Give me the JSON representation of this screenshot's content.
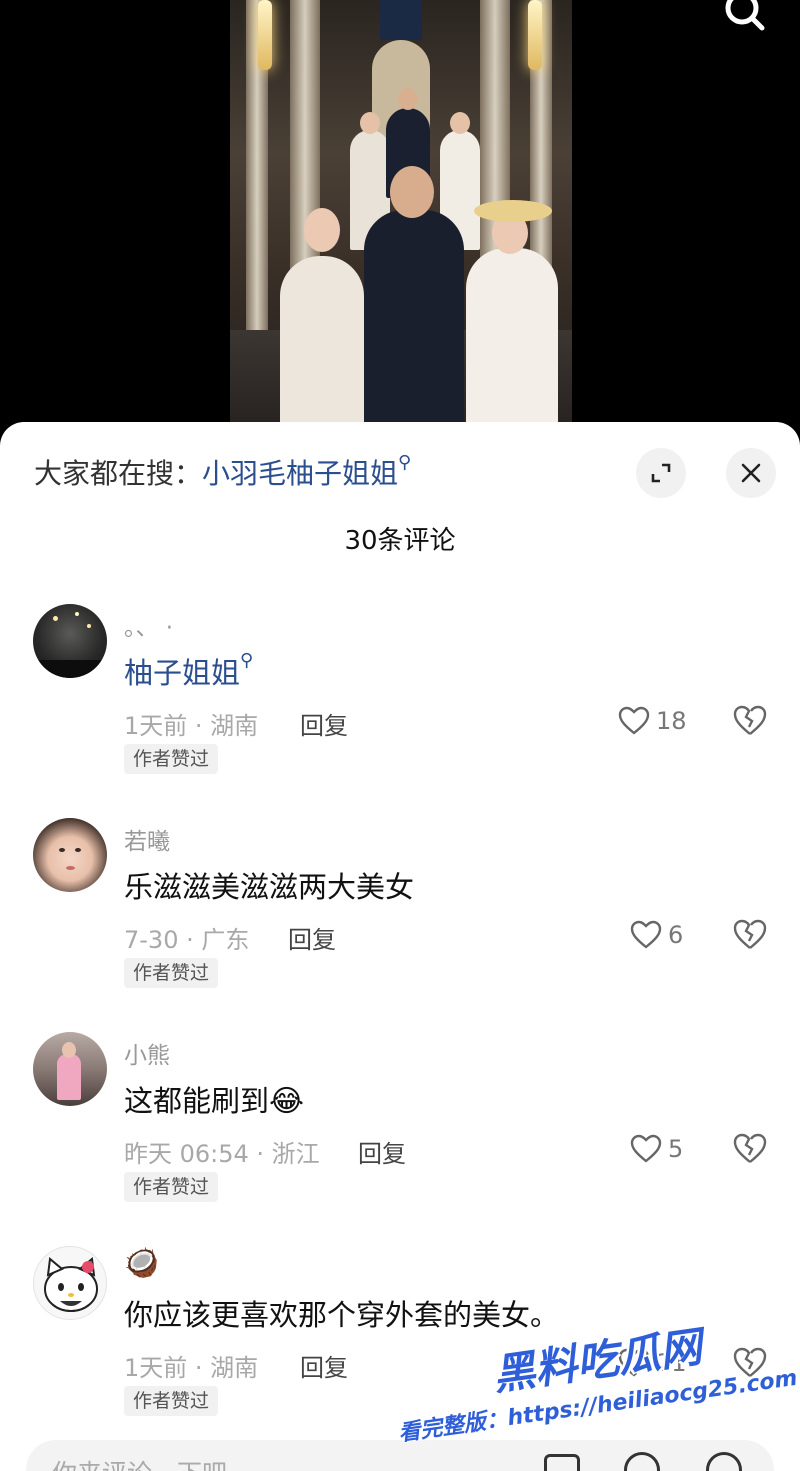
{
  "hot_search": {
    "prefix": "大家都在搜：",
    "term": "小羽毛柚子姐姐",
    "mag": "⚲"
  },
  "comment_count": "30条评论",
  "comments": [
    {
      "user": "。、 ·",
      "text": "柚子姐姐",
      "text_is_link": true,
      "mag": "⚲",
      "meta": "1天前 · 湖南",
      "reply": "回复",
      "badge": "作者赞过",
      "likes": "18",
      "avatar": "night-sky-photo-avatar"
    },
    {
      "user": "若曦",
      "text": "乐滋滋美滋滋两大美女",
      "meta": "7-30 · 广东",
      "reply": "回复",
      "badge": "作者赞过",
      "likes": "6",
      "avatar": "woman-portrait-avatar"
    },
    {
      "user": "小熊",
      "text": "这都能刷到",
      "emoji": "😂",
      "meta": "昨天 06:54 · 浙江",
      "reply": "回复",
      "badge": "作者赞过",
      "likes": "5",
      "avatar": "pink-outfit-photo-avatar"
    },
    {
      "user": "🥥",
      "text": "你应该更喜欢那个穿外套的美女。",
      "meta": "1天前 · 湖南",
      "reply": "回复",
      "badge": "作者赞过",
      "likes": "21",
      "avatar": "hello-kitty-avatar"
    }
  ],
  "input": {
    "placeholder": "你来评论一下吧"
  },
  "watermark": {
    "title": "黑料吃瓜网",
    "url": "看完整版：https://heiliaocg25.com"
  },
  "colors": {
    "link": "#2b4e8f",
    "watermark": "#2f5fd8"
  }
}
